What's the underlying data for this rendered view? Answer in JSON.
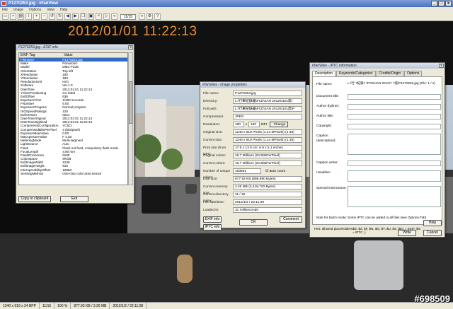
{
  "window": {
    "title": "P1270253.jpg - IrfanView",
    "min": "_",
    "max": "□",
    "close": "x"
  },
  "menu": [
    "File",
    "Image",
    "Options",
    "View",
    "Help"
  ],
  "toolbar": {
    "page": "11/15"
  },
  "overlay": {
    "timestamp": "2012/01/01 11:22:13",
    "watermark": "#698509"
  },
  "status": {
    "dims": "1240 x 919 x 24 BPP",
    "page": "11/15",
    "zoom": "100 %",
    "size": "877.92 KB / 3.26 MB",
    "date": "2012/1/2 / 22:11:08"
  },
  "exif": {
    "title": "P1270253.jpg - EXIF info",
    "col_tag": "EXIF Tag",
    "col_value": "Value",
    "rows": [
      [
        "Filename",
        "P1270253.jpg"
      ],
      [
        "Make",
        "Panasonic"
      ],
      [
        "Model",
        "DMC-FZ35"
      ],
      [
        "Orientation",
        "Top left"
      ],
      [
        "XResolution",
        "180"
      ],
      [
        "YResolution",
        "180"
      ],
      [
        "ResolutionUnit",
        "Inch"
      ],
      [
        "Software",
        "Ver.1.0"
      ],
      [
        "DateTime",
        "2012:01:01 11:22:13"
      ],
      [
        "YCbCrPositioning",
        "Co-Sited"
      ],
      [
        "ExifOffset",
        "636"
      ],
      [
        "ExposureTime",
        "1/200 seconds"
      ],
      [
        "FNumber",
        "5.00"
      ],
      [
        "ExposureProgram",
        "Normal program"
      ],
      [
        "ISOSpeedRatings",
        "125"
      ],
      [
        "ExifVersion",
        "0221"
      ],
      [
        "DateTimeOriginal",
        "2012:01:01 11:22:13"
      ],
      [
        "DateTimeDigitized",
        "2012:01:01 11:22:13"
      ],
      [
        "ComponentsConfiguration",
        "YCbCr"
      ],
      [
        "CompressedBitsPerPixel",
        "4 (bits/pixel)"
      ],
      [
        "ExposureBiasValue",
        "0.00"
      ],
      [
        "MaxApertureValue",
        "F 2.83"
      ],
      [
        "MeteringMode",
        "Multi-segment"
      ],
      [
        "LightSource",
        "Auto"
      ],
      [
        "Flash",
        "Flash not fired, compulsory flash mode"
      ],
      [
        "FocalLength",
        "4.80 mm"
      ],
      [
        "FlashPixVersion",
        "0100"
      ],
      [
        "ColorSpace",
        "sRGB"
      ],
      [
        "ExifImageWidth",
        "1248"
      ],
      [
        "ExifImageHeight",
        "919"
      ],
      [
        "InteroperabilityOffset",
        "10950"
      ],
      [
        "SensingMethod",
        "One-chip color area sensor"
      ]
    ],
    "copy_btn": "Copy to clipboard",
    "exit_btn": "Exit"
  },
  "props": {
    "title": "IrfanView - Image properties",
    "rows": [
      [
        "File name:",
        "P1270253.jpg"
      ],
      [
        "Directory:",
        "L:\\行車紀錄器\\FCD\\JAN 2012\\0101高\\"
      ],
      [
        "Full path:",
        "L:\\行車紀錄器\\FCD\\JAN 2012\\0101高\\P"
      ],
      [
        "Compression:",
        "JPEG"
      ]
    ],
    "res_label": "Resolution:",
    "res_x": "180",
    "res_y": "180",
    "dpi": "DPI",
    "change_btn": "Change",
    "rows2": [
      [
        "Original size:",
        "1240 x 919 Pixels (1.14 MPixels) (1.35)"
      ],
      [
        "Current size:",
        "1240 x 919 Pixels (1.14 MPixels) (1.35)"
      ],
      [
        "Print size (from DPI):",
        "17.5 x 13.0 cm; 6.9 x 5.1 inches"
      ],
      [
        "Original colors:",
        "16.7 Millions   (24 BitsPerPixel)"
      ],
      [
        "Current colors:",
        "16.7 Millions   (24 BitsPerPixel)"
      ]
    ],
    "unique_label": "Number of unique colors:",
    "unique_val": "163661",
    "auto_count": "auto count",
    "rows3": [
      [
        "Disk size:",
        "877.92 KB (898,990 Bytes)"
      ],
      [
        "Current memory size:",
        "3.26 MB (3,418,720 Bytes)"
      ],
      [
        "Current directory index:",
        "11 / 15"
      ],
      [
        "File date/time:",
        "2012/1/2 / 22:11:08"
      ],
      [
        "Loaded in:",
        "31 milliseconds"
      ]
    ],
    "exif_btn": "EXIF info",
    "iptc_btn": "IPTC info",
    "ok_btn": "OK",
    "comment_btn": "Comment"
  },
  "iptc": {
    "title": "IrfanView - IPTC information",
    "tabs": [
      "Description",
      "Keywords/Categories",
      "Credits/Origin",
      "Options"
    ],
    "file_label": "File name:",
    "file_val": "L:\\行    ?紀錄?     \\FCD\\JAN 2012\\?    ?道\\P1270253.jpg (File: 1 / 1)",
    "fields": [
      "Document title:",
      "Author (byline):",
      "Author title:",
      "Copyright:",
      "Caption (description):",
      "Caption writer:",
      "Headline:",
      "Special instructions:"
    ],
    "note": "Note for batch mode: Some IPTC can be added to all files (see Options-Tab)",
    "hint_label": "Hint: allowed placeholders:",
    "hint_val": "$D, $d, $F, $N, $O, $T, $U, $S, $Ex = EXIF, $Ix = IPTC..)",
    "help_btn": "Help",
    "write_btn": "Write",
    "cancel_btn": "Cancel"
  }
}
